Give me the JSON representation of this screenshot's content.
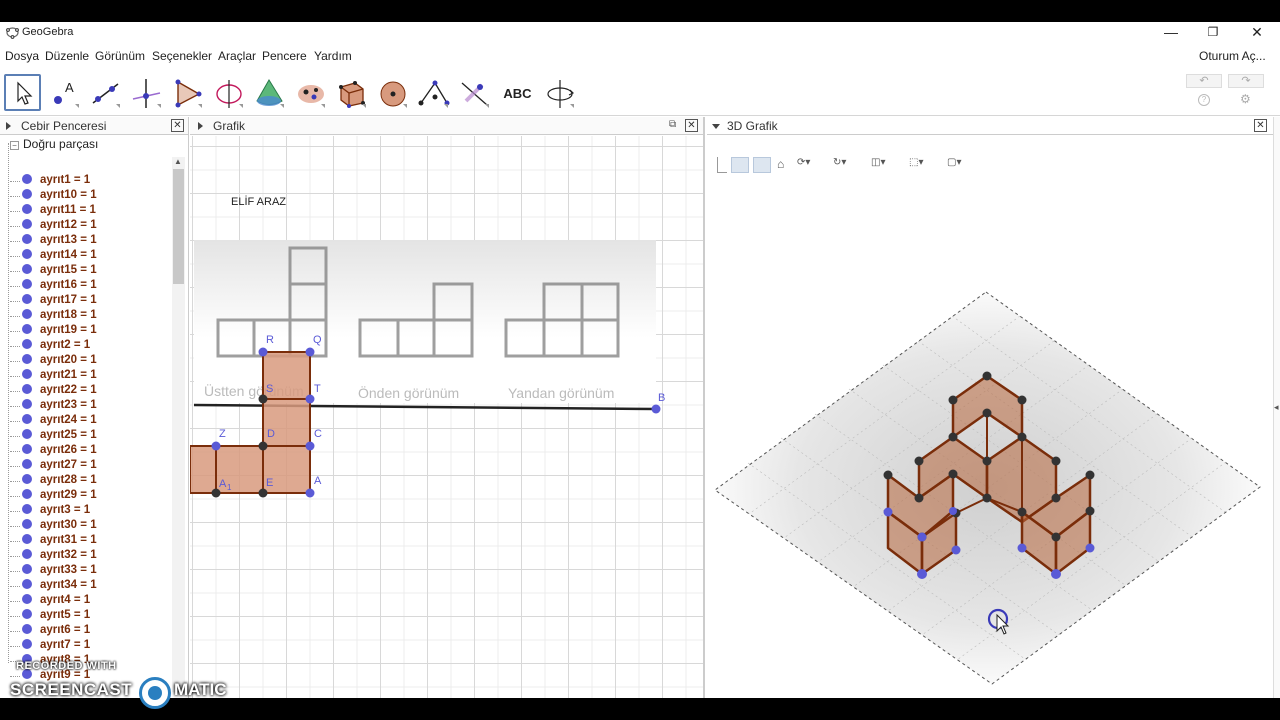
{
  "window": {
    "app_title": "GeoGebra",
    "controls": {
      "minimize": "—",
      "restore": "❐",
      "close": "✕"
    }
  },
  "menu": {
    "items": [
      "Dosya",
      "Düzenle",
      "Görünüm",
      "Seçenekler",
      "Araçlar",
      "Pencere",
      "Yardım"
    ],
    "login": "Oturum Aç..."
  },
  "toolbar": {
    "tools": [
      {
        "name": "move-tool-icon",
        "selected": true
      },
      {
        "name": "point-tool-icon"
      },
      {
        "name": "line-tool-icon"
      },
      {
        "name": "perpendicular-line-tool-icon"
      },
      {
        "name": "polygon-tool-icon"
      },
      {
        "name": "circle-tool-icon"
      },
      {
        "name": "pyramid-tool-icon"
      },
      {
        "name": "sphere-tool-icon"
      },
      {
        "name": "cube-tool-icon"
      },
      {
        "name": "sphere-point-tool-icon"
      },
      {
        "name": "angle-tool-icon"
      },
      {
        "name": "reflect-tool-icon"
      },
      {
        "name": "text-tool",
        "label": "ABC"
      },
      {
        "name": "rotate-view-tool-icon"
      }
    ],
    "undo": "↶",
    "redo": "↷",
    "help": "?",
    "settings": "⚙"
  },
  "algebra": {
    "title": "Cebir Penceresi",
    "close": "✕",
    "group": "Doğru parçası",
    "items": [
      "ayrıt1 = 1",
      "ayrıt10 = 1",
      "ayrıt11 = 1",
      "ayrıt12 = 1",
      "ayrıt13 = 1",
      "ayrıt14 = 1",
      "ayrıt15 = 1",
      "ayrıt16 = 1",
      "ayrıt17 = 1",
      "ayrıt18 = 1",
      "ayrıt19 = 1",
      "ayrıt2 = 1",
      "ayrıt20 = 1",
      "ayrıt21 = 1",
      "ayrıt22 = 1",
      "ayrıt23 = 1",
      "ayrıt24 = 1",
      "ayrıt25 = 1",
      "ayrıt26 = 1",
      "ayrıt27 = 1",
      "ayrıt28 = 1",
      "ayrıt29 = 1",
      "ayrıt3 = 1",
      "ayrıt30 = 1",
      "ayrıt31 = 1",
      "ayrıt32 = 1",
      "ayrıt33 = 1",
      "ayrıt34 = 1",
      "ayrıt4 = 1",
      "ayrıt5 = 1",
      "ayrıt6 = 1",
      "ayrıt7 = 1",
      "ayrıt8 = 1",
      "ayrıt9 = 1"
    ],
    "point_color": "#5a5ad6",
    "text_color": "#7a2d0a"
  },
  "graphics": {
    "title": "Grafik",
    "close": "✕",
    "author": "ELİF ARAZ",
    "view_labels": [
      "Üstten görünüm",
      "Önden görünüm",
      "Yandan görünüm"
    ],
    "point_labels": {
      "R": "R",
      "Q": "Q",
      "S": "S",
      "T": "T",
      "Z": "Z",
      "D": "D",
      "C": "C",
      "A1": "A",
      "A1_sub": "1",
      "E": "E",
      "A": "A",
      "B": "B"
    },
    "fill_color": "#d89a7e",
    "edge_color": "#7a2d0a"
  },
  "graphics3d": {
    "title": "3D Grafik",
    "close": "✕",
    "cube_color": "#b8673e",
    "edge_color": "#7a2d0a"
  },
  "watermark": {
    "line1": "RECORDED WITH",
    "line2": "SCREENCAST",
    "line3": "MATIC"
  },
  "status": {
    "help": "?"
  }
}
